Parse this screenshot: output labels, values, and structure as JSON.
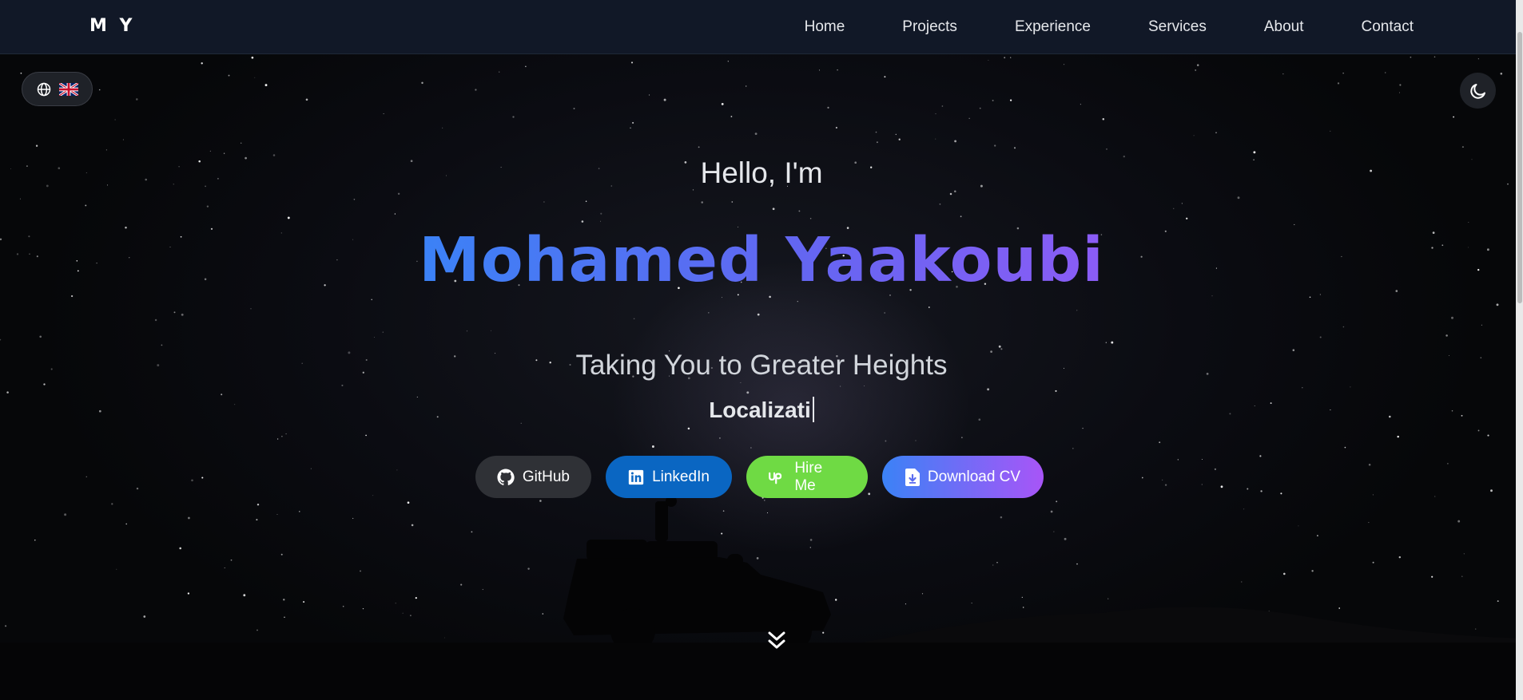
{
  "nav": {
    "logo": "M Y",
    "links": [
      "Home",
      "Projects",
      "Experience",
      "Services",
      "About",
      "Contact"
    ]
  },
  "controls": {
    "language_icon": "globe-icon",
    "language_flag": "uk-flag",
    "theme_icon": "moon-icon"
  },
  "hero": {
    "greeting": "Hello, I'm",
    "name": "Mohamed Yaakoubi",
    "tagline": "Taking You to Greater Heights",
    "typed_text": "Localizati"
  },
  "buttons": {
    "github": "GitHub",
    "linkedin": "LinkedIn",
    "hire": "Hire Me",
    "cv": "Download CV"
  },
  "colors": {
    "navbar_bg": "#111827",
    "name_gradient_start": "#3b82f6",
    "name_gradient_end": "#8b5cf6",
    "linkedin": "#0a66c2",
    "upwork": "#6fda44"
  }
}
